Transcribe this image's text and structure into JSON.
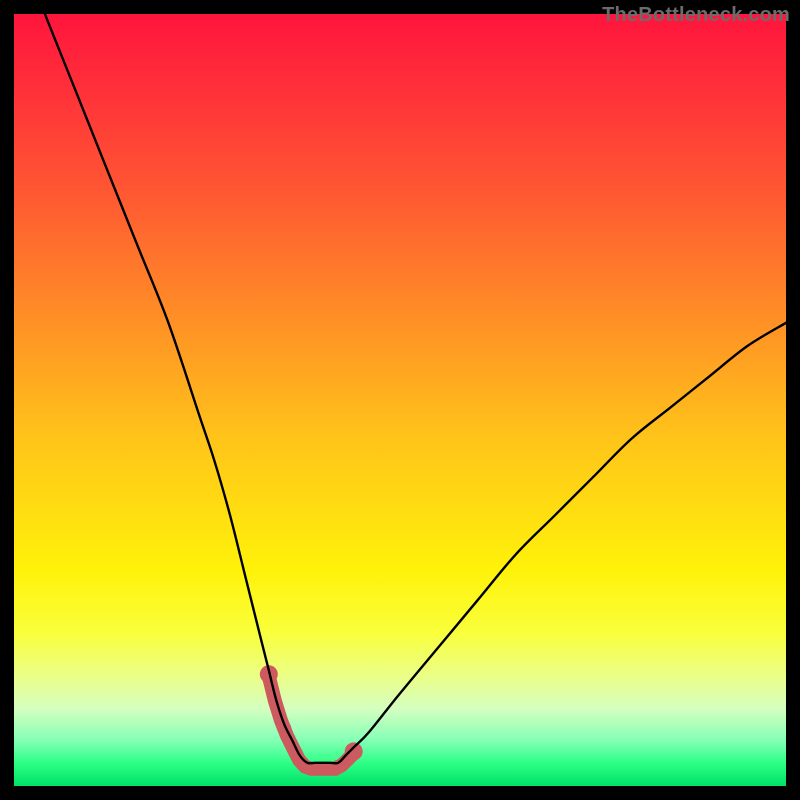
{
  "watermark": {
    "text": "TheBottleneck.com"
  },
  "colors": {
    "background": "#000000",
    "curve": "#000000",
    "flat_region": "#cd5a5f",
    "gradient_top": "#ff153d",
    "gradient_bottom": "#00e167"
  },
  "chart_data": {
    "type": "line",
    "title": "",
    "xlabel": "",
    "ylabel": "",
    "xlim": [
      0,
      100
    ],
    "ylim": [
      0,
      100
    ],
    "grid": false,
    "legend": false,
    "series": [
      {
        "name": "bottleneck-curve",
        "x": [
          4,
          8,
          12,
          16,
          20,
          24,
          26,
          28,
          30,
          32,
          33,
          34,
          35,
          36,
          37,
          38,
          39,
          40,
          41,
          42,
          43,
          44,
          46,
          50,
          55,
          60,
          65,
          70,
          75,
          80,
          85,
          90,
          95,
          100
        ],
        "y": [
          100,
          90,
          80,
          70,
          60,
          48,
          42,
          35,
          27,
          19,
          15,
          11,
          8,
          6,
          4,
          3,
          3,
          3,
          3,
          3,
          4,
          5,
          7,
          12,
          18,
          24,
          30,
          35,
          40,
          45,
          49,
          53,
          57,
          60
        ]
      }
    ],
    "flat_bottom_region": {
      "x_start": 33,
      "x_end": 44,
      "y": 3,
      "endpoint_dots": true,
      "style": "thick-rounded"
    },
    "background_gradient": {
      "direction": "vertical",
      "stops": [
        {
          "pos": 0.0,
          "color": "#ff153d"
        },
        {
          "pos": 0.22,
          "color": "#ff5433"
        },
        {
          "pos": 0.55,
          "color": "#ffc419"
        },
        {
          "pos": 0.8,
          "color": "#f9ff3a"
        },
        {
          "pos": 0.94,
          "color": "#86ffb6"
        },
        {
          "pos": 1.0,
          "color": "#00e167"
        }
      ]
    }
  }
}
